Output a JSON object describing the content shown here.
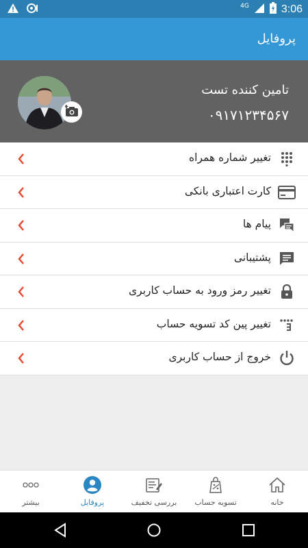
{
  "status_bar": {
    "time": "3:06",
    "network": "4G"
  },
  "app_bar": {
    "title": "پروفایل"
  },
  "profile": {
    "name": "تامین کننده تست",
    "phone": "۰۹۱۷۱۲۳۴۵۶۷"
  },
  "menu": {
    "items": [
      {
        "label": "تغییر شماره همراه",
        "icon": "dialpad-icon"
      },
      {
        "label": "کارت اعتباری بانکی",
        "icon": "credit-card-icon"
      },
      {
        "label": "پیام ها",
        "icon": "messages-icon"
      },
      {
        "label": "پشتیبانی",
        "icon": "support-chat-icon"
      },
      {
        "label": "تغییر رمز ورود به حساب کاربری",
        "icon": "lock-icon"
      },
      {
        "label": "تغییر پین کد تسویه حساب",
        "icon": "pin-keypad-icon"
      },
      {
        "label": "خروج از حساب کاربری",
        "icon": "power-icon"
      }
    ]
  },
  "bottom_nav": {
    "tabs": [
      {
        "label": "خانه",
        "icon": "home-icon"
      },
      {
        "label": "تسویه حساب",
        "icon": "settlement-icon"
      },
      {
        "label": "بررسی تخفیف",
        "icon": "discount-check-icon"
      },
      {
        "label": "پروفایل",
        "icon": "profile-icon",
        "active": true
      },
      {
        "label": "بیشتر",
        "icon": "more-icon"
      }
    ]
  },
  "colors": {
    "primary": "#3598d6",
    "status_bar": "#2b7fb2",
    "accent_chevron": "#e8452c",
    "header_bg": "#626262"
  }
}
